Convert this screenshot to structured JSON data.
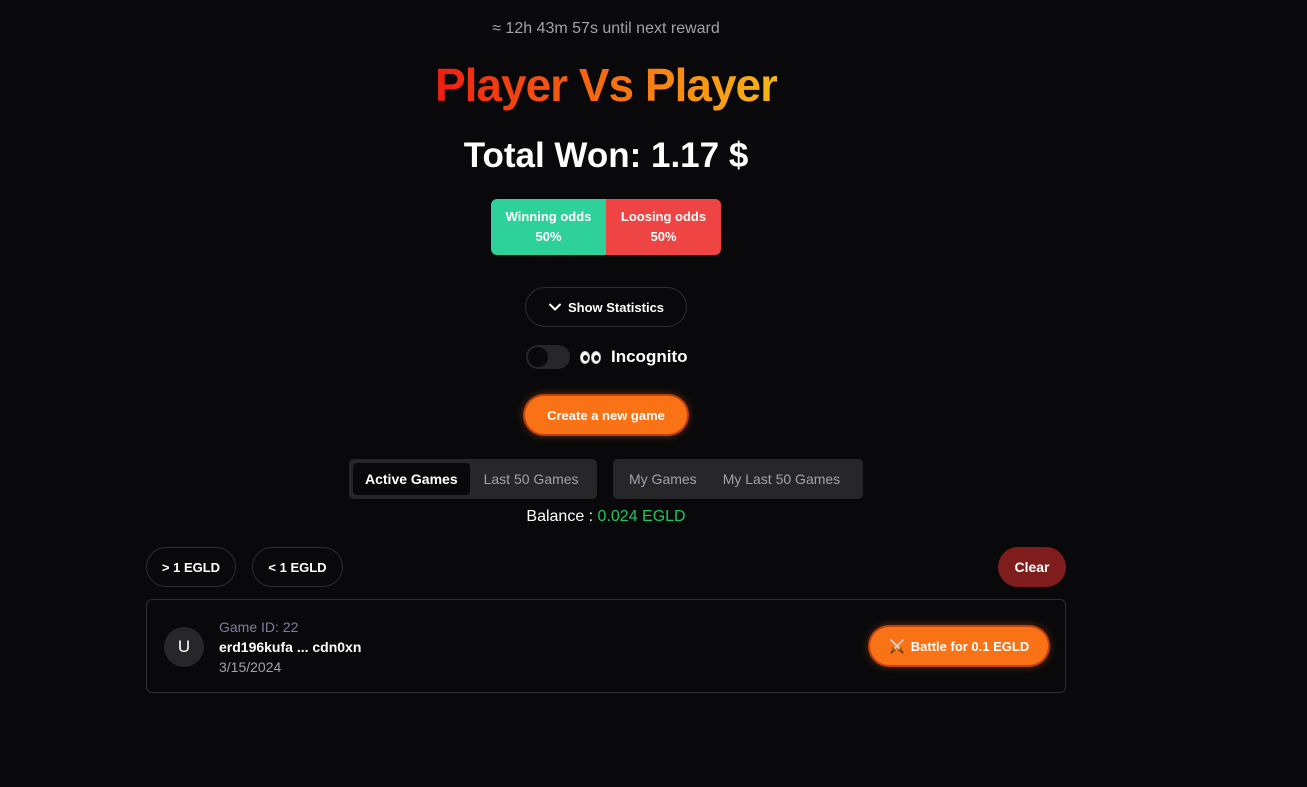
{
  "header": {
    "countdown": "≈ 12h 43m 57s until next reward",
    "title": "Player Vs Player",
    "total_won": "Total Won: 1.17 $"
  },
  "odds": {
    "winning_label": "Winning odds",
    "winning_value": "50%",
    "losing_label": "Loosing odds",
    "losing_value": "50%"
  },
  "controls": {
    "show_statistics": "Show Statistics",
    "incognito_label": "Incognito",
    "incognito_enabled": false,
    "create_game": "Create a new game"
  },
  "tabs": {
    "group1": [
      {
        "label": "Active Games",
        "active": true
      },
      {
        "label": "Last 50 Games",
        "active": false
      }
    ],
    "group2": [
      {
        "label": "My Games",
        "active": false
      },
      {
        "label": "My Last 50 Games",
        "active": false
      }
    ]
  },
  "balance": {
    "label": "Balance : ",
    "value": "0.024 EGLD"
  },
  "filters": {
    "gt": "> 1 EGLD",
    "lt": "< 1 EGLD",
    "clear": "Clear"
  },
  "games": [
    {
      "avatar": "U",
      "id": "Game ID: 22",
      "address": "erd196kufa ... cdn0xn",
      "date": "3/15/2024",
      "action": "Battle for 0.1 EGLD"
    }
  ],
  "colors": {
    "accent": "#f97316",
    "win": "#2fd19a",
    "lose": "#ef4444",
    "balance": "#22c55e",
    "clear": "#7f1d1d"
  }
}
